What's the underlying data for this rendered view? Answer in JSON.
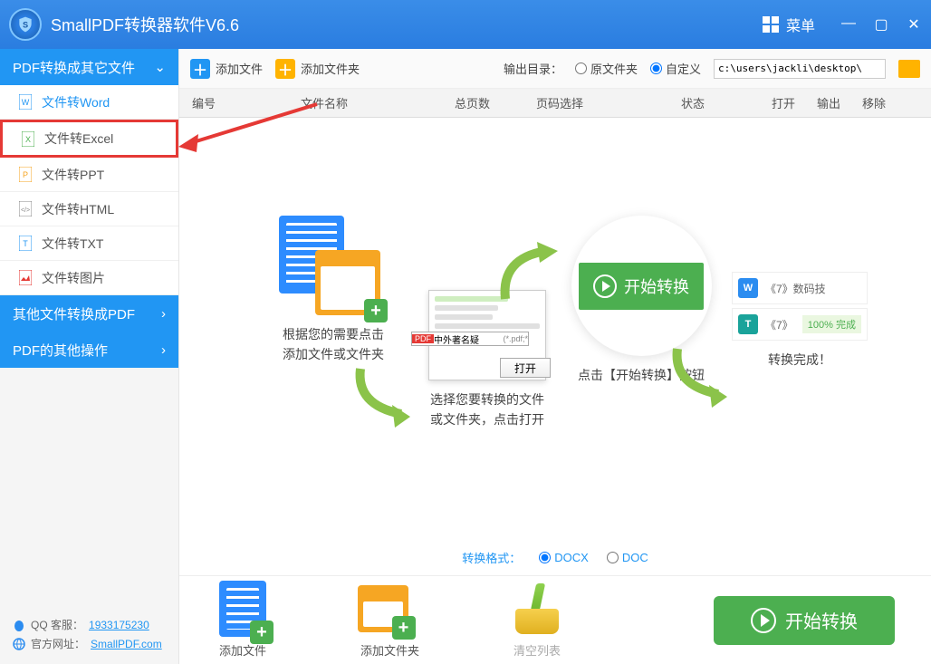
{
  "titlebar": {
    "title": "SmallPDF转换器软件V6.6",
    "menu": "菜单"
  },
  "sidebar": {
    "sections": [
      {
        "title": "PDF转换成其它文件"
      },
      {
        "title": "其他文件转换成PDF"
      },
      {
        "title": "PDF的其他操作"
      }
    ],
    "items": [
      {
        "label": "文件转Word"
      },
      {
        "label": "文件转Excel"
      },
      {
        "label": "文件转PPT"
      },
      {
        "label": "文件转HTML"
      },
      {
        "label": "文件转TXT"
      },
      {
        "label": "文件转图片"
      }
    ],
    "footer": {
      "qq_label": "QQ 客服：",
      "qq_value": "1933175230",
      "site_label": "官方网址：",
      "site_value": "SmallPDF.com"
    }
  },
  "toolbar": {
    "add_file": "添加文件",
    "add_folder": "添加文件夹",
    "output_label": "输出目录：",
    "opt_original": "原文件夹",
    "opt_custom": "自定义",
    "path": "c:\\users\\jackli\\desktop\\"
  },
  "columns": {
    "num": "编号",
    "name": "文件名称",
    "pages": "总页数",
    "range": "页码选择",
    "status": "状态",
    "open": "打开",
    "output": "输出",
    "remove": "移除"
  },
  "steps": {
    "s1": "根据您的需要点击\n添加文件或文件夹",
    "s2": "选择您要转换的文件\n或文件夹，点击打开",
    "s2_filename": "中外著名疑",
    "s2_ext": "(*.pdf;*",
    "s2_open": "打开",
    "s2_pdf": "PDF",
    "s3_btn": "开始转换",
    "s3_caption": "点击【开始转换】按钮",
    "s4_row1": "《7》数码技",
    "s4_row2": "《7》",
    "s4_pct": "100%  完成",
    "s4_caption": "转换完成！"
  },
  "format": {
    "label": "转换格式：",
    "docx": "DOCX",
    "doc": "DOC"
  },
  "bottom": {
    "add_file": "添加文件",
    "add_folder": "添加文件夹",
    "clear": "清空列表",
    "start": "开始转换"
  }
}
